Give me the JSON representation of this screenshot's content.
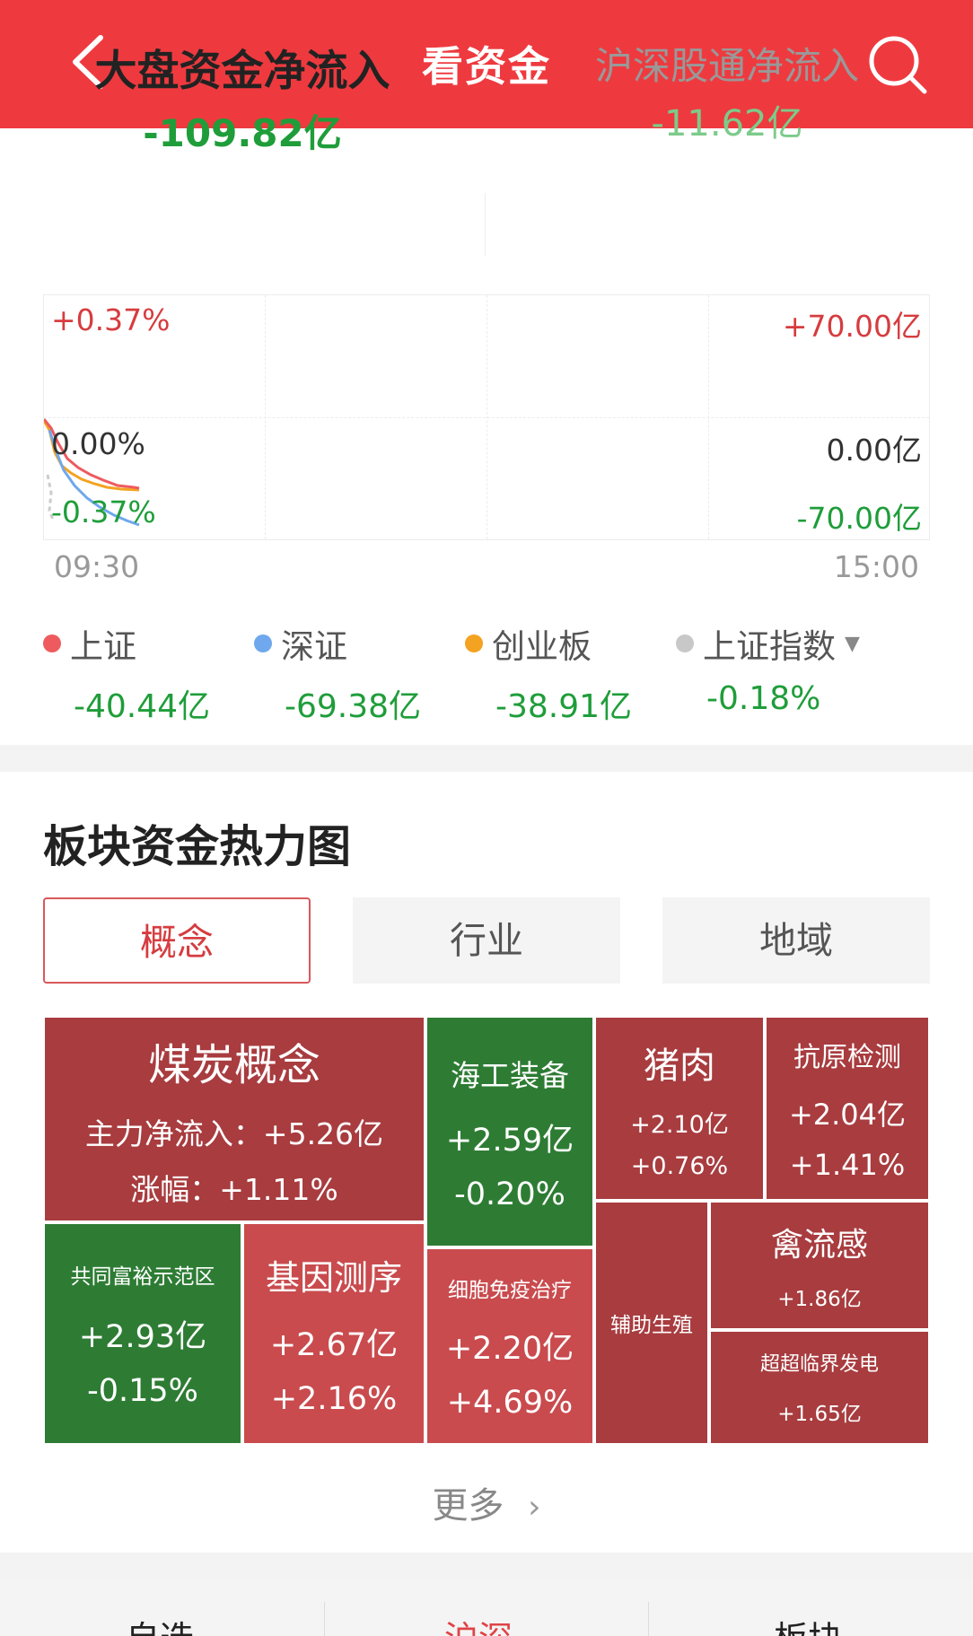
{
  "header": {
    "title": "看资金"
  },
  "flow": {
    "main_label": "大盘资金净流入",
    "main_value": "-109.82亿",
    "secondary_label": "沪深股通净流入",
    "secondary_value": "-11.62亿"
  },
  "chart": {
    "left_top": "+0.37%",
    "left_mid": "0.00%",
    "left_bottom": "-0.37%",
    "right_top": "+70.00亿",
    "right_mid": "0.00亿",
    "right_bottom": "-70.00亿",
    "time_start": "09:30",
    "time_end": "15:00"
  },
  "legend": [
    {
      "name": "上证",
      "value": "-40.44亿",
      "color": "#ee5b5f"
    },
    {
      "name": "深证",
      "value": "-69.38亿",
      "color": "#6fa8ec"
    },
    {
      "name": "创业板",
      "value": "-38.91亿",
      "color": "#f3a321"
    },
    {
      "name": "上证指数",
      "value": "-0.18%",
      "color": "#c8c8c8"
    }
  ],
  "heatmap_section": {
    "title": "板块资金热力图",
    "tabs": [
      "概念",
      "行业",
      "地域"
    ]
  },
  "tiles": {
    "coal": {
      "name": "煤炭概念",
      "inflow": "主力净流入：+5.26亿",
      "change": "涨幅：+1.11%"
    },
    "offshore": {
      "name": "海工装备",
      "inflow": "+2.59亿",
      "change": "-0.20%"
    },
    "pork": {
      "name": "猪肉",
      "inflow": "+2.10亿",
      "change": "+0.76%"
    },
    "antigen": {
      "name": "抗原检测",
      "inflow": "+2.04亿",
      "change": "+1.41%"
    },
    "common": {
      "name": "共同富裕示范区",
      "inflow": "+2.93亿",
      "change": "-0.15%"
    },
    "gene": {
      "name": "基因测序",
      "inflow": "+2.67亿",
      "change": "+2.16%"
    },
    "cell": {
      "name": "细胞免疫治疗",
      "inflow": "+2.20亿",
      "change": "+4.69%"
    },
    "repro": {
      "name": "辅助生殖"
    },
    "flu": {
      "name": "禽流感",
      "inflow": "+1.86亿"
    },
    "power": {
      "name": "超超临界发电",
      "inflow": "+1.65亿"
    }
  },
  "more_label": "更多",
  "bottom_tabs": [
    "自选",
    "沪深",
    "板块"
  ]
}
